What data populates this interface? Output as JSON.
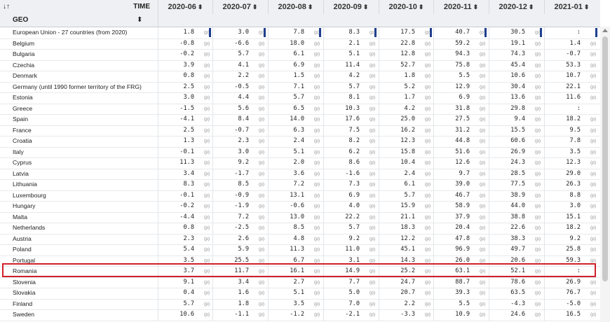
{
  "header": {
    "sort_icon_text": "↓↑",
    "time_label": "TIME",
    "geo_label": "GEO",
    "geo_sort_text": "⬍",
    "columns": [
      "2020-06",
      "2020-07",
      "2020-08",
      "2020-09",
      "2020-10",
      "2020-11",
      "2020-12",
      "2021-01"
    ]
  },
  "rows": [
    {
      "geo": "European Union - 27 countries (from 2020)",
      "values": [
        [
          "1.8",
          "(p)"
        ],
        [
          "3.0",
          "(p)"
        ],
        [
          "7.8",
          "(p)"
        ],
        [
          "8.3",
          "(p)"
        ],
        [
          "17.5",
          "(p)"
        ],
        [
          "40.7",
          "(p)"
        ],
        [
          "30.5",
          "(p)"
        ],
        [
          ":",
          ""
        ]
      ]
    },
    {
      "geo": "Belgium",
      "values": [
        [
          "-0.8",
          "(p)"
        ],
        [
          "-6.6",
          "(p)"
        ],
        [
          "18.0",
          "(p)"
        ],
        [
          "2.1",
          "(p)"
        ],
        [
          "22.8",
          "(p)"
        ],
        [
          "59.2",
          "(p)"
        ],
        [
          "19.1",
          "(p)"
        ],
        [
          "1.4",
          "(p)"
        ]
      ]
    },
    {
      "geo": "Bulgaria",
      "values": [
        [
          "-0.2",
          "(p)"
        ],
        [
          "5.7",
          "(p)"
        ],
        [
          "6.1",
          "(p)"
        ],
        [
          "5.1",
          "(p)"
        ],
        [
          "12.8",
          "(p)"
        ],
        [
          "94.3",
          "(p)"
        ],
        [
          "74.3",
          "(p)"
        ],
        [
          "-0.7",
          "(p)"
        ]
      ]
    },
    {
      "geo": "Czechia",
      "values": [
        [
          "3.9",
          "(p)"
        ],
        [
          "4.1",
          "(p)"
        ],
        [
          "6.9",
          "(p)"
        ],
        [
          "11.4",
          "(p)"
        ],
        [
          "52.7",
          "(p)"
        ],
        [
          "75.8",
          "(p)"
        ],
        [
          "45.4",
          "(p)"
        ],
        [
          "53.3",
          "(p)"
        ]
      ]
    },
    {
      "geo": "Denmark",
      "values": [
        [
          "0.8",
          "(p)"
        ],
        [
          "2.2",
          "(p)"
        ],
        [
          "1.5",
          "(p)"
        ],
        [
          "4.2",
          "(p)"
        ],
        [
          "1.8",
          "(p)"
        ],
        [
          "5.5",
          "(p)"
        ],
        [
          "10.6",
          "(p)"
        ],
        [
          "10.7",
          "(p)"
        ]
      ]
    },
    {
      "geo": "Germany (until 1990 former territory of the FRG)",
      "values": [
        [
          "2.5",
          "(p)"
        ],
        [
          "-0.5",
          "(p)"
        ],
        [
          "7.1",
          "(p)"
        ],
        [
          "5.7",
          "(p)"
        ],
        [
          "5.2",
          "(p)"
        ],
        [
          "12.9",
          "(p)"
        ],
        [
          "30.4",
          "(p)"
        ],
        [
          "22.1",
          "(p)"
        ]
      ]
    },
    {
      "geo": "Estonia",
      "values": [
        [
          "3.0",
          "(p)"
        ],
        [
          "4.4",
          "(p)"
        ],
        [
          "5.7",
          "(p)"
        ],
        [
          "8.1",
          "(p)"
        ],
        [
          "1.7",
          "(p)"
        ],
        [
          "6.9",
          "(p)"
        ],
        [
          "13.6",
          "(p)"
        ],
        [
          "11.6",
          "(p)"
        ]
      ]
    },
    {
      "geo": "Greece",
      "values": [
        [
          "-1.5",
          "(p)"
        ],
        [
          "5.6",
          "(p)"
        ],
        [
          "6.5",
          "(p)"
        ],
        [
          "10.3",
          "(p)"
        ],
        [
          "4.2",
          "(p)"
        ],
        [
          "31.8",
          "(p)"
        ],
        [
          "29.8",
          "(p)"
        ],
        [
          ":",
          ""
        ]
      ]
    },
    {
      "geo": "Spain",
      "values": [
        [
          "-4.1",
          "(p)"
        ],
        [
          "8.4",
          "(p)"
        ],
        [
          "14.0",
          "(p)"
        ],
        [
          "17.6",
          "(p)"
        ],
        [
          "25.0",
          "(p)"
        ],
        [
          "27.5",
          "(p)"
        ],
        [
          "9.4",
          "(p)"
        ],
        [
          "18.2",
          "(p)"
        ]
      ]
    },
    {
      "geo": "France",
      "values": [
        [
          "2.5",
          "(p)"
        ],
        [
          "-0.7",
          "(p)"
        ],
        [
          "6.3",
          "(p)"
        ],
        [
          "7.5",
          "(p)"
        ],
        [
          "16.2",
          "(p)"
        ],
        [
          "31.2",
          "(p)"
        ],
        [
          "15.5",
          "(p)"
        ],
        [
          "9.5",
          "(p)"
        ]
      ]
    },
    {
      "geo": "Croatia",
      "values": [
        [
          "1.3",
          "(p)"
        ],
        [
          "2.3",
          "(p)"
        ],
        [
          "2.4",
          "(p)"
        ],
        [
          "8.2",
          "(p)"
        ],
        [
          "12.3",
          "(p)"
        ],
        [
          "44.8",
          "(p)"
        ],
        [
          "60.6",
          "(p)"
        ],
        [
          "7.8",
          "(p)"
        ]
      ]
    },
    {
      "geo": "Italy",
      "values": [
        [
          "-0.1",
          "(p)"
        ],
        [
          "3.0",
          "(p)"
        ],
        [
          "5.1",
          "(p)"
        ],
        [
          "6.2",
          "(p)"
        ],
        [
          "15.8",
          "(p)"
        ],
        [
          "51.6",
          "(p)"
        ],
        [
          "26.9",
          "(p)"
        ],
        [
          "3.5",
          "(p)"
        ]
      ]
    },
    {
      "geo": "Cyprus",
      "values": [
        [
          "11.3",
          "(p)"
        ],
        [
          "9.2",
          "(p)"
        ],
        [
          "2.0",
          "(p)"
        ],
        [
          "8.6",
          "(p)"
        ],
        [
          "10.4",
          "(p)"
        ],
        [
          "12.6",
          "(p)"
        ],
        [
          "24.3",
          "(p)"
        ],
        [
          "12.3",
          "(p)"
        ]
      ]
    },
    {
      "geo": "Latvia",
      "values": [
        [
          "3.4",
          "(p)"
        ],
        [
          "-1.7",
          "(p)"
        ],
        [
          "3.6",
          "(p)"
        ],
        [
          "-1.6",
          "(p)"
        ],
        [
          "2.4",
          "(p)"
        ],
        [
          "9.7",
          "(p)"
        ],
        [
          "28.5",
          "(p)"
        ],
        [
          "29.0",
          "(p)"
        ]
      ]
    },
    {
      "geo": "Lithuania",
      "values": [
        [
          "8.3",
          "(p)"
        ],
        [
          "8.5",
          "(p)"
        ],
        [
          "7.2",
          "(p)"
        ],
        [
          "7.3",
          "(p)"
        ],
        [
          "6.1",
          "(p)"
        ],
        [
          "39.0",
          "(p)"
        ],
        [
          "77.5",
          "(p)"
        ],
        [
          "26.3",
          "(p)"
        ]
      ]
    },
    {
      "geo": "Luxembourg",
      "values": [
        [
          "-0.1",
          "(p)"
        ],
        [
          "-0.9",
          "(p)"
        ],
        [
          "13.1",
          "(p)"
        ],
        [
          "6.9",
          "(p)"
        ],
        [
          "5.7",
          "(p)"
        ],
        [
          "46.7",
          "(p)"
        ],
        [
          "38.9",
          "(p)"
        ],
        [
          "8.8",
          "(p)"
        ]
      ]
    },
    {
      "geo": "Hungary",
      "values": [
        [
          "-0.2",
          "(p)"
        ],
        [
          "-1.9",
          "(p)"
        ],
        [
          "-0.6",
          "(p)"
        ],
        [
          "4.0",
          "(p)"
        ],
        [
          "15.9",
          "(p)"
        ],
        [
          "58.9",
          "(p)"
        ],
        [
          "44.0",
          "(p)"
        ],
        [
          "3.0",
          "(p)"
        ]
      ]
    },
    {
      "geo": "Malta",
      "values": [
        [
          "-4.4",
          "(p)"
        ],
        [
          "7.2",
          "(p)"
        ],
        [
          "13.0",
          "(p)"
        ],
        [
          "22.2",
          "(p)"
        ],
        [
          "21.1",
          "(p)"
        ],
        [
          "37.9",
          "(p)"
        ],
        [
          "38.8",
          "(p)"
        ],
        [
          "15.1",
          "(p)"
        ]
      ]
    },
    {
      "geo": "Netherlands",
      "values": [
        [
          "0.8",
          "(p)"
        ],
        [
          "-2.5",
          "(p)"
        ],
        [
          "8.5",
          "(p)"
        ],
        [
          "5.7",
          "(p)"
        ],
        [
          "18.3",
          "(p)"
        ],
        [
          "20.4",
          "(p)"
        ],
        [
          "22.6",
          "(p)"
        ],
        [
          "18.2",
          "(p)"
        ]
      ]
    },
    {
      "geo": "Austria",
      "values": [
        [
          "2.3",
          "(p)"
        ],
        [
          "2.6",
          "(p)"
        ],
        [
          "4.8",
          "(p)"
        ],
        [
          "9.2",
          "(p)"
        ],
        [
          "12.2",
          "(p)"
        ],
        [
          "47.8",
          "(p)"
        ],
        [
          "38.3",
          "(p)"
        ],
        [
          "9.2",
          "(p)"
        ]
      ]
    },
    {
      "geo": "Poland",
      "values": [
        [
          "5.4",
          "(p)"
        ],
        [
          "5.9",
          "(p)"
        ],
        [
          "11.3",
          "(p)"
        ],
        [
          "11.0",
          "(p)"
        ],
        [
          "45.1",
          "(p)"
        ],
        [
          "96.9",
          "(p)"
        ],
        [
          "49.7",
          "(p)"
        ],
        [
          "25.8",
          "(p)"
        ]
      ]
    },
    {
      "geo": "Portugal",
      "values": [
        [
          "3.5",
          "(p)"
        ],
        [
          "25.5",
          "(p)"
        ],
        [
          "6.7",
          "(p)"
        ],
        [
          "3.1",
          "(p)"
        ],
        [
          "14.3",
          "(p)"
        ],
        [
          "26.0",
          "(p)"
        ],
        [
          "20.6",
          "(p)"
        ],
        [
          "59.3",
          "(p)"
        ]
      ]
    },
    {
      "geo": "Romania",
      "values": [
        [
          "3.7",
          "(p)"
        ],
        [
          "11.7",
          "(p)"
        ],
        [
          "16.1",
          "(p)"
        ],
        [
          "14.9",
          "(p)"
        ],
        [
          "25.2",
          "(p)"
        ],
        [
          "63.1",
          "(p)"
        ],
        [
          "52.1",
          "(p)"
        ],
        [
          ":",
          ""
        ]
      ]
    },
    {
      "geo": "Slovenia",
      "values": [
        [
          "9.1",
          "(p)"
        ],
        [
          "3.4",
          "(p)"
        ],
        [
          "2.7",
          "(p)"
        ],
        [
          "7.7",
          "(p)"
        ],
        [
          "24.7",
          "(p)"
        ],
        [
          "88.7",
          "(p)"
        ],
        [
          "78.6",
          "(p)"
        ],
        [
          "26.9",
          "(p)"
        ]
      ]
    },
    {
      "geo": "Slovakia",
      "values": [
        [
          "0.4",
          "(p)"
        ],
        [
          "1.6",
          "(p)"
        ],
        [
          "5.1",
          "(p)"
        ],
        [
          "5.0",
          "(p)"
        ],
        [
          "20.7",
          "(p)"
        ],
        [
          "39.3",
          "(p)"
        ],
        [
          "63.5",
          "(p)"
        ],
        [
          "76.7",
          "(p)"
        ]
      ]
    },
    {
      "geo": "Finland",
      "values": [
        [
          "5.7",
          "(p)"
        ],
        [
          "1.8",
          "(p)"
        ],
        [
          "3.5",
          "(p)"
        ],
        [
          "7.0",
          "(p)"
        ],
        [
          "2.2",
          "(p)"
        ],
        [
          "5.5",
          "(p)"
        ],
        [
          "-4.3",
          "(p)"
        ],
        [
          "-5.0",
          "(p)"
        ]
      ]
    },
    {
      "geo": "Sweden",
      "values": [
        [
          "10.6",
          "(p)"
        ],
        [
          "-1.1",
          "(p)"
        ],
        [
          "-1.2",
          "(p)"
        ],
        [
          "-2.1",
          "(p)"
        ],
        [
          "-3.3",
          "(p)"
        ],
        [
          "10.9",
          "(p)"
        ],
        [
          "24.6",
          "(p)"
        ],
        [
          "16.5",
          "(p)"
        ]
      ]
    }
  ],
  "highlight_row": "Romania",
  "colors": {
    "header_bg": "#eef0f3",
    "highlight": "#d0202a",
    "eu_bar": "#1f3f8f"
  }
}
